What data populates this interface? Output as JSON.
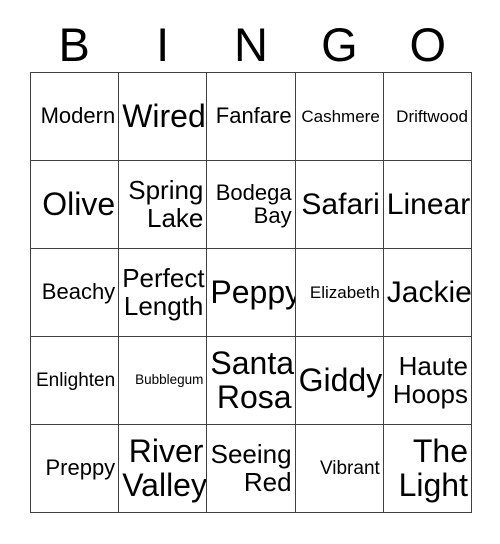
{
  "card": {
    "type": "bingo-card",
    "columns": 5,
    "rows": 5,
    "background_color": "#ffffff",
    "border_color": "#404040",
    "text_color": "#000000"
  },
  "header": {
    "letters": [
      {
        "label": "B"
      },
      {
        "label": "I"
      },
      {
        "label": "N"
      },
      {
        "label": "G"
      },
      {
        "label": "O"
      }
    ]
  },
  "grid": {
    "cells": [
      {
        "label": "Modern",
        "size": "m"
      },
      {
        "label": "Wired",
        "size": "xxl"
      },
      {
        "label": "Fanfare",
        "size": "m"
      },
      {
        "label": "Cashmere",
        "size": "xs"
      },
      {
        "label": "Driftwood",
        "size": "xs"
      },
      {
        "label": "Olive",
        "size": "xxl"
      },
      {
        "label": "Spring Lake",
        "size": "l"
      },
      {
        "label": "Bodega Bay",
        "size": "m"
      },
      {
        "label": "Safari",
        "size": "xl"
      },
      {
        "label": "Linear",
        "size": "xl"
      },
      {
        "label": "Beachy",
        "size": "m"
      },
      {
        "label": "Perfect Length",
        "size": "l"
      },
      {
        "label": "Peppy",
        "size": "xxl"
      },
      {
        "label": "Elizabeth",
        "size": "xs"
      },
      {
        "label": "Jackie",
        "size": "xl"
      },
      {
        "label": "Enlighten",
        "size": "s"
      },
      {
        "label": "Bubblegum",
        "size": "tiny"
      },
      {
        "label": "Santa Rosa",
        "size": "xxl"
      },
      {
        "label": "Giddy",
        "size": "xxl"
      },
      {
        "label": "Haute Hoops",
        "size": "l"
      },
      {
        "label": "Preppy",
        "size": "m"
      },
      {
        "label": "River Valley",
        "size": "xxl"
      },
      {
        "label": "Seeing Red",
        "size": "l"
      },
      {
        "label": "Vibrant",
        "size": "s"
      },
      {
        "label": "The Light",
        "size": "xxl"
      }
    ]
  }
}
